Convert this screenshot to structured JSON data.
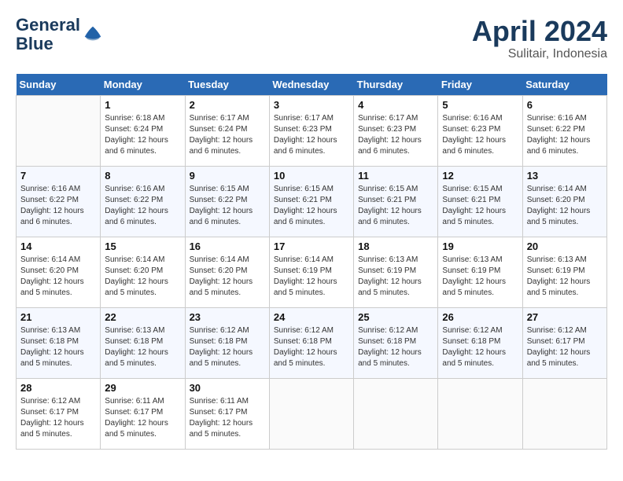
{
  "header": {
    "logo_line1": "General",
    "logo_line2": "Blue",
    "month": "April 2024",
    "location": "Sulitair, Indonesia"
  },
  "days_of_week": [
    "Sunday",
    "Monday",
    "Tuesday",
    "Wednesday",
    "Thursday",
    "Friday",
    "Saturday"
  ],
  "weeks": [
    [
      {
        "num": "",
        "sunrise": "",
        "sunset": "",
        "daylight": ""
      },
      {
        "num": "1",
        "sunrise": "Sunrise: 6:18 AM",
        "sunset": "Sunset: 6:24 PM",
        "daylight": "Daylight: 12 hours and 6 minutes."
      },
      {
        "num": "2",
        "sunrise": "Sunrise: 6:17 AM",
        "sunset": "Sunset: 6:24 PM",
        "daylight": "Daylight: 12 hours and 6 minutes."
      },
      {
        "num": "3",
        "sunrise": "Sunrise: 6:17 AM",
        "sunset": "Sunset: 6:23 PM",
        "daylight": "Daylight: 12 hours and 6 minutes."
      },
      {
        "num": "4",
        "sunrise": "Sunrise: 6:17 AM",
        "sunset": "Sunset: 6:23 PM",
        "daylight": "Daylight: 12 hours and 6 minutes."
      },
      {
        "num": "5",
        "sunrise": "Sunrise: 6:16 AM",
        "sunset": "Sunset: 6:23 PM",
        "daylight": "Daylight: 12 hours and 6 minutes."
      },
      {
        "num": "6",
        "sunrise": "Sunrise: 6:16 AM",
        "sunset": "Sunset: 6:22 PM",
        "daylight": "Daylight: 12 hours and 6 minutes."
      }
    ],
    [
      {
        "num": "7",
        "sunrise": "Sunrise: 6:16 AM",
        "sunset": "Sunset: 6:22 PM",
        "daylight": "Daylight: 12 hours and 6 minutes."
      },
      {
        "num": "8",
        "sunrise": "Sunrise: 6:16 AM",
        "sunset": "Sunset: 6:22 PM",
        "daylight": "Daylight: 12 hours and 6 minutes."
      },
      {
        "num": "9",
        "sunrise": "Sunrise: 6:15 AM",
        "sunset": "Sunset: 6:22 PM",
        "daylight": "Daylight: 12 hours and 6 minutes."
      },
      {
        "num": "10",
        "sunrise": "Sunrise: 6:15 AM",
        "sunset": "Sunset: 6:21 PM",
        "daylight": "Daylight: 12 hours and 6 minutes."
      },
      {
        "num": "11",
        "sunrise": "Sunrise: 6:15 AM",
        "sunset": "Sunset: 6:21 PM",
        "daylight": "Daylight: 12 hours and 6 minutes."
      },
      {
        "num": "12",
        "sunrise": "Sunrise: 6:15 AM",
        "sunset": "Sunset: 6:21 PM",
        "daylight": "Daylight: 12 hours and 5 minutes."
      },
      {
        "num": "13",
        "sunrise": "Sunrise: 6:14 AM",
        "sunset": "Sunset: 6:20 PM",
        "daylight": "Daylight: 12 hours and 5 minutes."
      }
    ],
    [
      {
        "num": "14",
        "sunrise": "Sunrise: 6:14 AM",
        "sunset": "Sunset: 6:20 PM",
        "daylight": "Daylight: 12 hours and 5 minutes."
      },
      {
        "num": "15",
        "sunrise": "Sunrise: 6:14 AM",
        "sunset": "Sunset: 6:20 PM",
        "daylight": "Daylight: 12 hours and 5 minutes."
      },
      {
        "num": "16",
        "sunrise": "Sunrise: 6:14 AM",
        "sunset": "Sunset: 6:20 PM",
        "daylight": "Daylight: 12 hours and 5 minutes."
      },
      {
        "num": "17",
        "sunrise": "Sunrise: 6:14 AM",
        "sunset": "Sunset: 6:19 PM",
        "daylight": "Daylight: 12 hours and 5 minutes."
      },
      {
        "num": "18",
        "sunrise": "Sunrise: 6:13 AM",
        "sunset": "Sunset: 6:19 PM",
        "daylight": "Daylight: 12 hours and 5 minutes."
      },
      {
        "num": "19",
        "sunrise": "Sunrise: 6:13 AM",
        "sunset": "Sunset: 6:19 PM",
        "daylight": "Daylight: 12 hours and 5 minutes."
      },
      {
        "num": "20",
        "sunrise": "Sunrise: 6:13 AM",
        "sunset": "Sunset: 6:19 PM",
        "daylight": "Daylight: 12 hours and 5 minutes."
      }
    ],
    [
      {
        "num": "21",
        "sunrise": "Sunrise: 6:13 AM",
        "sunset": "Sunset: 6:18 PM",
        "daylight": "Daylight: 12 hours and 5 minutes."
      },
      {
        "num": "22",
        "sunrise": "Sunrise: 6:13 AM",
        "sunset": "Sunset: 6:18 PM",
        "daylight": "Daylight: 12 hours and 5 minutes."
      },
      {
        "num": "23",
        "sunrise": "Sunrise: 6:12 AM",
        "sunset": "Sunset: 6:18 PM",
        "daylight": "Daylight: 12 hours and 5 minutes."
      },
      {
        "num": "24",
        "sunrise": "Sunrise: 6:12 AM",
        "sunset": "Sunset: 6:18 PM",
        "daylight": "Daylight: 12 hours and 5 minutes."
      },
      {
        "num": "25",
        "sunrise": "Sunrise: 6:12 AM",
        "sunset": "Sunset: 6:18 PM",
        "daylight": "Daylight: 12 hours and 5 minutes."
      },
      {
        "num": "26",
        "sunrise": "Sunrise: 6:12 AM",
        "sunset": "Sunset: 6:18 PM",
        "daylight": "Daylight: 12 hours and 5 minutes."
      },
      {
        "num": "27",
        "sunrise": "Sunrise: 6:12 AM",
        "sunset": "Sunset: 6:17 PM",
        "daylight": "Daylight: 12 hours and 5 minutes."
      }
    ],
    [
      {
        "num": "28",
        "sunrise": "Sunrise: 6:12 AM",
        "sunset": "Sunset: 6:17 PM",
        "daylight": "Daylight: 12 hours and 5 minutes."
      },
      {
        "num": "29",
        "sunrise": "Sunrise: 6:11 AM",
        "sunset": "Sunset: 6:17 PM",
        "daylight": "Daylight: 12 hours and 5 minutes."
      },
      {
        "num": "30",
        "sunrise": "Sunrise: 6:11 AM",
        "sunset": "Sunset: 6:17 PM",
        "daylight": "Daylight: 12 hours and 5 minutes."
      },
      {
        "num": "",
        "sunrise": "",
        "sunset": "",
        "daylight": ""
      },
      {
        "num": "",
        "sunrise": "",
        "sunset": "",
        "daylight": ""
      },
      {
        "num": "",
        "sunrise": "",
        "sunset": "",
        "daylight": ""
      },
      {
        "num": "",
        "sunrise": "",
        "sunset": "",
        "daylight": ""
      }
    ]
  ]
}
